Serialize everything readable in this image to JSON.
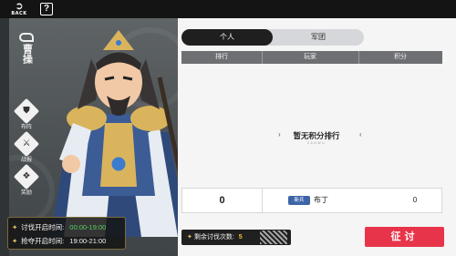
{
  "topbar": {
    "back_label": "BACK",
    "help_label": "?"
  },
  "character": {
    "name": "曹操"
  },
  "side_buttons": [
    {
      "icon": "formation-icon",
      "label": "布阵"
    },
    {
      "icon": "battle-report-icon",
      "label": "战报"
    },
    {
      "icon": "reward-icon",
      "label": "奖励"
    }
  ],
  "times": {
    "open_label": "讨伐开启时间:",
    "open_value": "00:00-19:00",
    "grab_label": "抢夺开启时间:",
    "grab_value": "19:00-21:00"
  },
  "tabs": [
    {
      "label": "个人",
      "active": true
    },
    {
      "label": "军团",
      "active": false
    }
  ],
  "table": {
    "headers": [
      "排行",
      "玩家",
      "积分"
    ],
    "empty_text": "暂无积分排行",
    "empty_sub": "ZANWU"
  },
  "my_entry": {
    "rank": "0",
    "badge": "新兵",
    "name": "布丁",
    "score": "0"
  },
  "remaining": {
    "label": "剩余讨伐次数:",
    "count": "5"
  },
  "attack_button": {
    "label": "征讨"
  },
  "colors": {
    "accent_red": "#e8344a",
    "time_green": "#58d15e",
    "gold": "#e6c36a"
  }
}
